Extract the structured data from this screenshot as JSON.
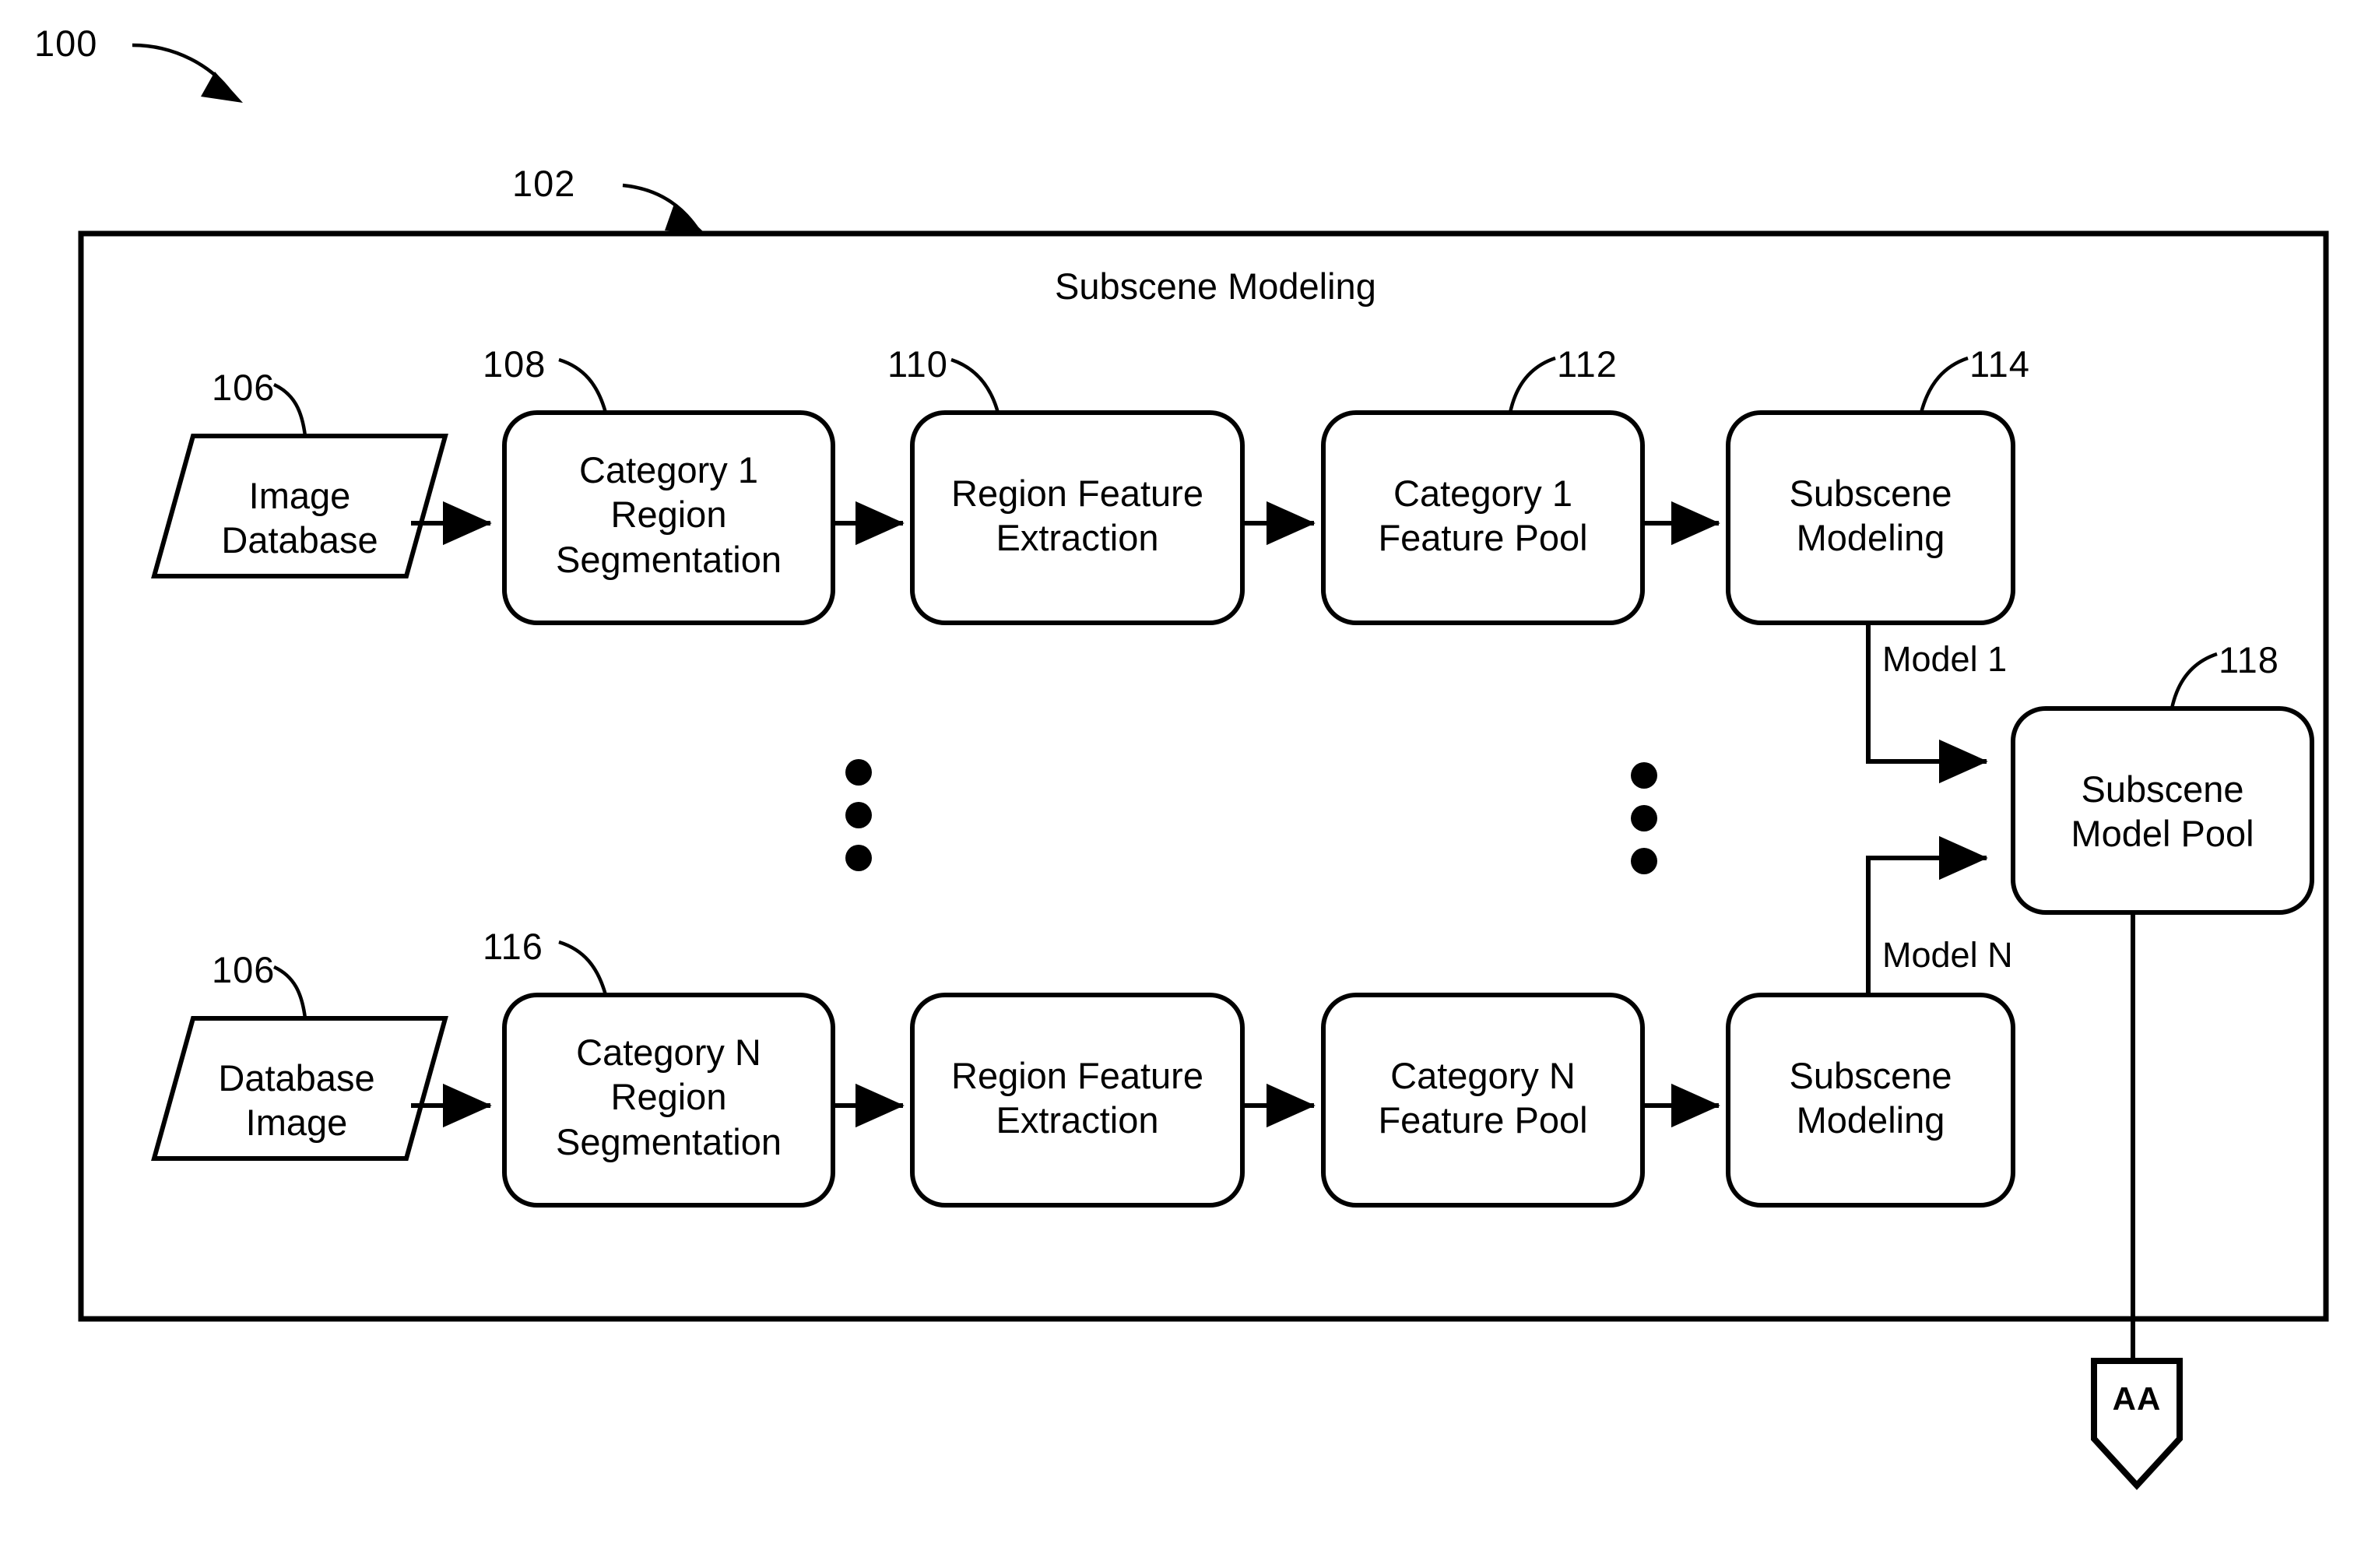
{
  "figure": {
    "ref_label": "100",
    "container": {
      "ref_label": "102",
      "title": "Subscene Modeling"
    },
    "nodes": [
      {
        "id": "image-database",
        "ref_label": "106",
        "shape": "parallelogram",
        "line1": "Image",
        "line2": "Database"
      },
      {
        "id": "category-1-region-segmentation",
        "ref_label": "108",
        "shape": "rounded-rect",
        "line1": "Category 1",
        "line2": "Region",
        "line3": "Segmentation"
      },
      {
        "id": "region-feature-extraction-1",
        "ref_label": "110",
        "shape": "rounded-rect",
        "line1": "Region Feature",
        "line2": "Extraction"
      },
      {
        "id": "category-1-feature-pool",
        "ref_label": "112",
        "shape": "rounded-rect",
        "line1": "Category 1",
        "line2": "Feature Pool"
      },
      {
        "id": "subscene-modeling-1",
        "ref_label": "114",
        "shape": "rounded-rect",
        "line1": "Subscene",
        "line2": "Modeling"
      },
      {
        "id": "database-image",
        "ref_label": "106",
        "shape": "parallelogram",
        "line1": "Database",
        "line2": "Image"
      },
      {
        "id": "category-n-region-segmentation",
        "ref_label": "116",
        "shape": "rounded-rect",
        "line1": "Category N",
        "line2": "Region",
        "line3": "Segmentation"
      },
      {
        "id": "region-feature-extraction-n",
        "ref_label": "",
        "shape": "rounded-rect",
        "line1": "Region Feature",
        "line2": "Extraction"
      },
      {
        "id": "category-n-feature-pool",
        "ref_label": "",
        "shape": "rounded-rect",
        "line1": "Category N",
        "line2": "Feature Pool"
      },
      {
        "id": "subscene-modeling-n",
        "ref_label": "",
        "shape": "rounded-rect",
        "line1": "Subscene",
        "line2": "Modeling"
      },
      {
        "id": "subscene-model-pool",
        "ref_label": "118",
        "shape": "rounded-rect",
        "line1": "Subscene",
        "line2": "Model Pool"
      }
    ],
    "edge_labels": {
      "model_1": "Model 1",
      "model_n": "Model N"
    },
    "offpage_connector": {
      "label": "AA"
    },
    "ellipsis": {
      "glyph": "•",
      "columns": 2,
      "dots_per_column": 3
    },
    "colors": {
      "stroke": "#000000",
      "fill": "#ffffff",
      "text": "#000000"
    }
  }
}
